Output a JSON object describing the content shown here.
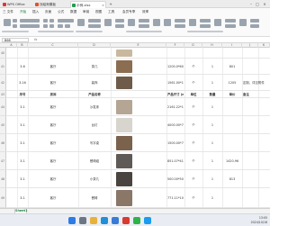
{
  "tabs": [
    {
      "label": "WPS Office",
      "color": "#d83b2f"
    },
    {
      "label": "找稻壳模板",
      "color": "#e0512a"
    },
    {
      "label": "示例.xlsx",
      "color": "#1e9e4f"
    }
  ],
  "menu": [
    "三 文件",
    "开始",
    "插入",
    "页面",
    "公式",
    "数据",
    "审阅",
    "视图",
    "工具",
    "会员专享",
    "效率"
  ],
  "active_menu": "开始",
  "formula": {
    "name_box": "B66",
    "fx": "fx"
  },
  "columns": [
    "A",
    "B",
    "C",
    "D",
    "E",
    "F",
    "G",
    "H",
    "I",
    "J",
    "K"
  ],
  "rows": [
    {
      "num": "40",
      "a": "",
      "b": "",
      "c": "",
      "size": "",
      "unit": "",
      "qty": "",
      "price": "",
      "note": "",
      "img": "#c9b8a0"
    },
    {
      "num": "41",
      "a": "3-6",
      "b": "客厅",
      "c": "茶几",
      "size": "1200.0*600.0*450.0",
      "unit": "个",
      "qty": "1",
      "price": "801",
      "note": "",
      "img": "#8b6d52"
    },
    {
      "num": "42",
      "a": "3-16",
      "b": "客厅",
      "c": "装饰",
      "size": "1561.00*1572.11*0.75",
      "unit": "个",
      "qty": "1",
      "price": "1205",
      "note": "定制，详见附件",
      "img": "#6f5b4a"
    },
    {
      "num": "43",
      "a": "序号",
      "b": "房间",
      "c": "产品名称",
      "size": "产品尺寸 (mm)",
      "unit": "单位",
      "qty": "数量",
      "price": "单价",
      "note": "备注",
      "img": ""
    },
    {
      "num": "44",
      "a": "3-1",
      "b": "客厅",
      "c": "沙发床",
      "size": "2161.22*1720.00*810.0",
      "unit": "个",
      "qty": "1",
      "price": "",
      "note": "",
      "img": "#b4a595"
    },
    {
      "num": "45",
      "a": "3-1",
      "b": "客厅",
      "c": "台灯",
      "size": "4000.00*750.00*2000.0",
      "unit": "个",
      "qty": "1",
      "price": "",
      "note": "",
      "img": "#d8d4ce"
    },
    {
      "num": "46",
      "a": "3-1",
      "b": "客厅",
      "c": "写字桌",
      "size": "1500.00*750.00*700.0",
      "unit": "个",
      "qty": "1",
      "price": "",
      "note": "",
      "img": "#7b624c"
    },
    {
      "num": "47",
      "a": "3-1",
      "b": "客厅",
      "c": "餐椅组",
      "size": "851.07*417.98*1211.70",
      "unit": "个",
      "qty": "1",
      "price": "1420.96",
      "note": "",
      "img": "#5f5a55"
    },
    {
      "num": "48",
      "a": "3-1",
      "b": "客厅",
      "c": "小茶几",
      "size": "500.00*500.00*500.0",
      "unit": "个",
      "qty": "1",
      "price": "813",
      "note": "",
      "img": "#4a4440"
    },
    {
      "num": "49",
      "a": "3-1",
      "b": "客厅",
      "c": "餐椅",
      "size": "771.11*1098.13*995.62",
      "unit": "个",
      "qty": "1",
      "price": "",
      "note": "",
      "img": "#8a7768"
    }
  ],
  "sheet_tab": "Sheet1",
  "taskbar": {
    "icons": [
      {
        "name": "start-icon",
        "color": "#2d7be5"
      },
      {
        "name": "search-taskbar-icon",
        "color": "#6b7785"
      },
      {
        "name": "file-explorer-icon",
        "color": "#e8b13a"
      },
      {
        "name": "edge-icon",
        "color": "#1f8fd8"
      },
      {
        "name": "store-icon",
        "color": "#3a7bd5"
      },
      {
        "name": "wps-icon",
        "color": "#d83b2f"
      },
      {
        "name": "wechat-icon",
        "color": "#2db34a"
      },
      {
        "name": "qq-icon",
        "color": "#1a9bf0"
      }
    ],
    "time": "13:05",
    "date": "2024/10/16"
  }
}
